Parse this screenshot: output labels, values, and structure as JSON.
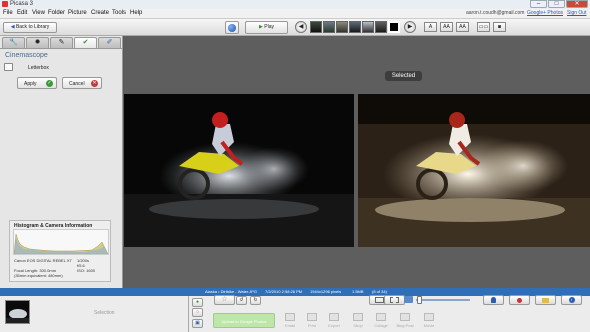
{
  "window": {
    "title": "Picasa 3",
    "min": "–",
    "max": "□",
    "close": "✕"
  },
  "menubar": {
    "items": [
      "File",
      "Edit",
      "View",
      "Folder",
      "Picture",
      "Create",
      "Tools",
      "Help"
    ],
    "account": "aaron.t.coudh@gmail.com",
    "links": [
      "Google+ Photos",
      "Sign Out"
    ]
  },
  "toolbar": {
    "back_label": "Back to Library",
    "play_label": "Play",
    "prev": "◀",
    "next": "▶",
    "view_buttons": [
      "A",
      "AA",
      "AA"
    ]
  },
  "left_panel": {
    "tabs": [
      "wrench",
      "sun",
      "brush",
      "brush-check",
      "brush-pen"
    ],
    "effect_title": "Cinemascope",
    "letterbox_label": "Letterbox",
    "apply_label": "Apply",
    "cancel_label": "Cancel",
    "histogram_title": "Histogram & Camera Information",
    "camera": "Canon EOS DIGITAL REBEL XT",
    "exposure": "1/200s",
    "aperture": "f/5.6",
    "focal_length": "Focal Length: 300.0mm",
    "iso": "ISO: 1600",
    "equiv": "(35mm equivalent: 480mm)"
  },
  "canvas": {
    "selected_badge": "Selected"
  },
  "statusbar": {
    "filename": "Alaska • Dirtbike - Water.JPG",
    "date": "7/2/2010 2:58:26 PM",
    "dimensions": "1944x1296 pixels",
    "size": "1.5MB",
    "index": "(8 of 34)"
  },
  "tray": {
    "selection_label": "Selection",
    "upload_label": "Upload to Google Photos",
    "actions": [
      "Email",
      "Print",
      "Export",
      "Shop",
      "Collage",
      "Blog Post",
      "Movie"
    ]
  },
  "colors": {
    "status_blue": "#2f6fb8",
    "accent_green": "#3a9a3a",
    "cancel_red": "#c53a3a"
  }
}
